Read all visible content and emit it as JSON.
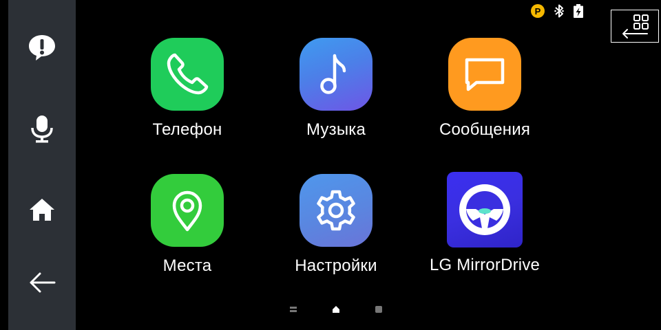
{
  "sidebar": {
    "items": [
      {
        "icon": "alert-bubble-icon"
      },
      {
        "icon": "microphone-icon"
      },
      {
        "icon": "home-icon"
      },
      {
        "icon": "back-arrow-icon"
      }
    ]
  },
  "status_bar": {
    "parking_badge": "P",
    "icons": [
      "bluetooth-icon",
      "battery-charging-icon"
    ]
  },
  "apps": [
    {
      "label": "Телефон",
      "icon": "phone-icon",
      "color": "#1fcc5a"
    },
    {
      "label": "Музыка",
      "icon": "music-note-icon",
      "color": "#4c7fe8"
    },
    {
      "label": "Сообщения",
      "icon": "message-icon",
      "color": "#ff9a1f"
    },
    {
      "label": "Места",
      "icon": "location-pin-icon",
      "color": "#33cc3c"
    },
    {
      "label": "Настройки",
      "icon": "gear-icon",
      "color": "#5a86e0"
    },
    {
      "label": "LG MirrorDrive",
      "icon": "steering-wheel-icon",
      "color": "#3a2fe0"
    }
  ],
  "page_indicator": {
    "pages": 3,
    "current": 2
  },
  "right_panel": {
    "icon": "switch-view-icon"
  }
}
